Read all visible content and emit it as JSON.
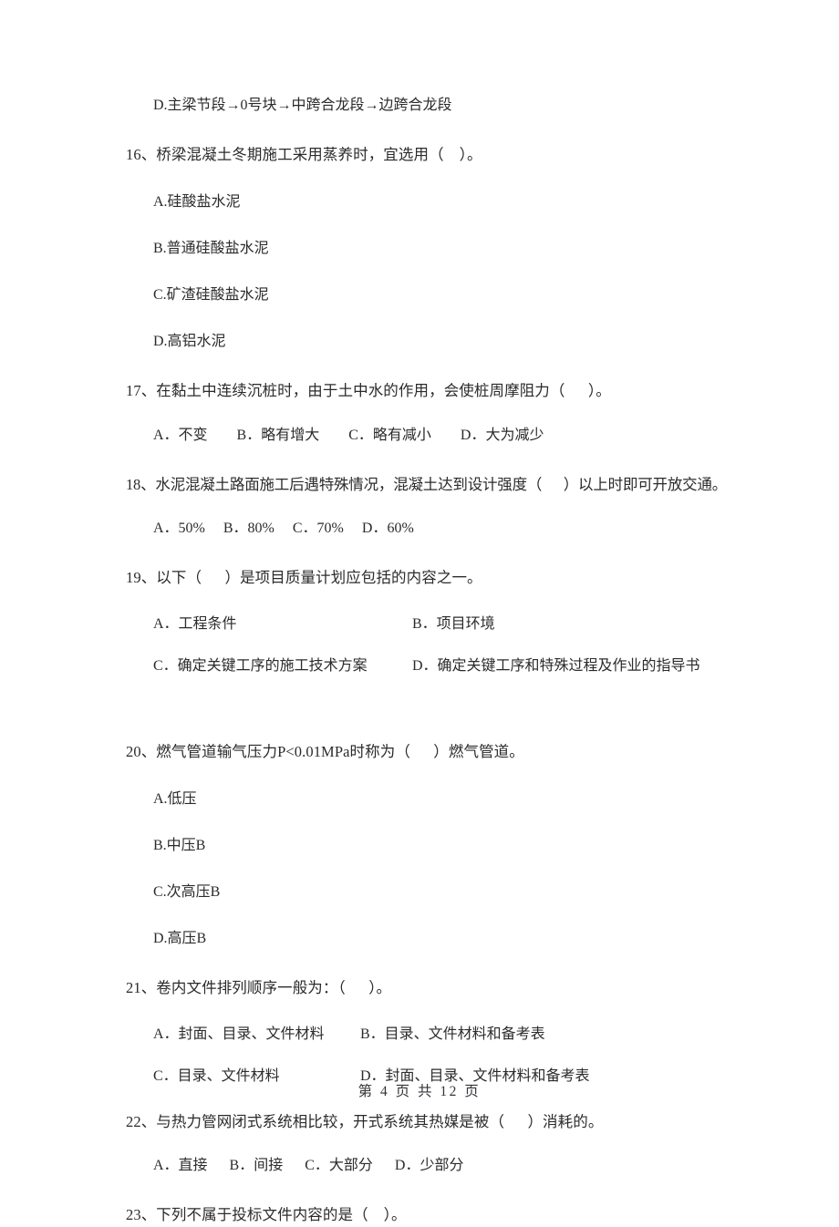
{
  "document": {
    "type": "exam-paper",
    "language": "zh-CN"
  },
  "top_fragment": {
    "option": "D.主梁节段→0号块→中跨合龙段→边跨合龙段"
  },
  "questions": [
    {
      "number": "16、",
      "stem": "16、桥梁混凝土冬期施工采用蒸养时，宜选用（    ）。",
      "layout": "stacked",
      "options": [
        "A.硅酸盐水泥",
        "B.普通硅酸盐水泥",
        "C.矿渣硅酸盐水泥",
        "D.高铝水泥"
      ]
    },
    {
      "number": "17、",
      "stem": "17、在黏土中连续沉桩时，由于土中水的作用，会使桩周摩阻力（      ）。",
      "layout": "inline",
      "options_inline": "A．不变        B．略有增大        C．略有减小        D．大为减少"
    },
    {
      "number": "18、",
      "stem": "18、水泥混凝土路面施工后遇特殊情况，混凝土达到设计强度（      ）以上时即可开放交通。",
      "layout": "inline",
      "options_inline": "A．50%     B．80%     C．70%     D．60%"
    },
    {
      "number": "19、",
      "stem": "19、以下（      ）是项目质量计划应包括的内容之一。",
      "layout": "two-column-wide",
      "rows": [
        {
          "left": "A．工程条件",
          "right": "B．项目环境"
        },
        {
          "left": "C．确定关键工序的施工技术方案",
          "right": "D．确定关键工序和特殊过程及作业的指导书"
        }
      ]
    },
    {
      "number": "20、",
      "stem": "20、燃气管道输气压力P<0.01MPa时称为（      ）燃气管道。",
      "layout": "stacked",
      "options": [
        "A.低压",
        "B.中压B",
        "C.次高压B",
        "D.高压B"
      ]
    },
    {
      "number": "21、",
      "stem": "21、卷内文件排列顺序一般为：（      ）。",
      "layout": "two-column-narrow",
      "rows": [
        {
          "left": "A．封面、目录、文件材料",
          "right": "B．目录、文件材料和备考表"
        },
        {
          "left": "C．目录、文件材料",
          "right": "D．封面、目录、文件材料和备考表"
        }
      ]
    },
    {
      "number": "22、",
      "stem": "22、与热力管网闭式系统相比较，开式系统其热媒是被（      ）消耗的。",
      "layout": "inline",
      "options_inline": "A．直接      B．间接      C．大部分      D．少部分"
    },
    {
      "number": "23、",
      "stem": "23、下列不属于投标文件内容的是（    ）。",
      "layout": "stem-only",
      "options": []
    }
  ],
  "footer": {
    "text": "第 4 页 共 12 页"
  }
}
